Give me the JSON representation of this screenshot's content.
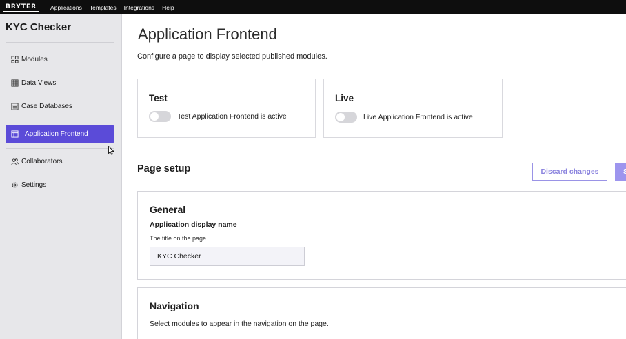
{
  "topbar": {
    "logo": "BRYTER",
    "nav": [
      "Applications",
      "Templates",
      "Integrations",
      "Help"
    ]
  },
  "sidebar": {
    "app_title": "KYC Checker",
    "items": [
      {
        "label": "Modules",
        "icon": "grid-icon"
      },
      {
        "label": "Data Views",
        "icon": "table-icon"
      },
      {
        "label": "Case Databases",
        "icon": "database-icon"
      },
      {
        "label": "Application Frontend",
        "icon": "frontend-layout-icon",
        "active": true
      },
      {
        "label": "Collaborators",
        "icon": "users-icon"
      },
      {
        "label": "Settings",
        "icon": "gear-icon"
      }
    ]
  },
  "main": {
    "title": "Application Frontend",
    "description": "Configure a page to display selected published modules.",
    "cards": [
      {
        "title": "Test",
        "toggle_label": "Test Application Frontend is active",
        "active": false
      },
      {
        "title": "Live",
        "toggle_label": "Live Application Frontend is active",
        "active": false
      }
    ],
    "page_setup": {
      "title": "Page setup",
      "discard_label": "Discard changes",
      "save_label": "S"
    },
    "general": {
      "title": "General",
      "field_label": "Application display name",
      "field_help": "The title on the page.",
      "field_value": "KYC Checker"
    },
    "navigation": {
      "title": "Navigation",
      "description": "Select modules to appear in the navigation on the page."
    }
  },
  "colors": {
    "accent": "#5b4bd8",
    "topbar": "#0e0e0e",
    "sidebar_bg": "#e7e7ea"
  }
}
